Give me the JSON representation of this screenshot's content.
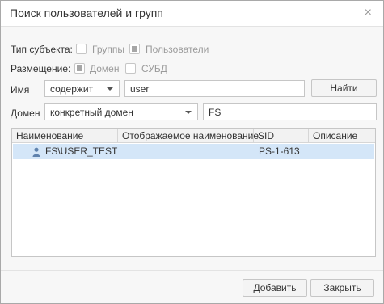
{
  "dialog": {
    "title": "Поиск пользователей и групп",
    "close_symbol": "×"
  },
  "subject_type": {
    "label": "Тип субъекта:",
    "groups_label": "Группы",
    "groups_checked": false,
    "users_label": "Пользователи",
    "users_checked": true
  },
  "placement": {
    "label": "Размещение:",
    "domain_label": "Домен",
    "domain_checked": true,
    "dbms_label": "СУБД",
    "dbms_checked": false
  },
  "name_filter": {
    "label": "Имя",
    "condition": "содержит",
    "value": "user",
    "find_button": "Найти"
  },
  "domain_filter": {
    "label": "Домен",
    "mode": "конкретный домен",
    "value": "FS"
  },
  "results": {
    "columns": [
      "Наименование",
      "Отображаемое наименование",
      "SID",
      "Описание"
    ],
    "rows": [
      {
        "icon": "user-icon",
        "name": "FS\\USER_TEST",
        "display_name": "",
        "sid": "PS-1-613",
        "description": "",
        "selected": true
      }
    ]
  },
  "footer": {
    "add_button": "Добавить",
    "close_button": "Закрыть"
  },
  "colors": {
    "selected_row": "#d4e6f8",
    "dialog_bg": "#f7f7f7",
    "border": "#c6c6c6"
  }
}
